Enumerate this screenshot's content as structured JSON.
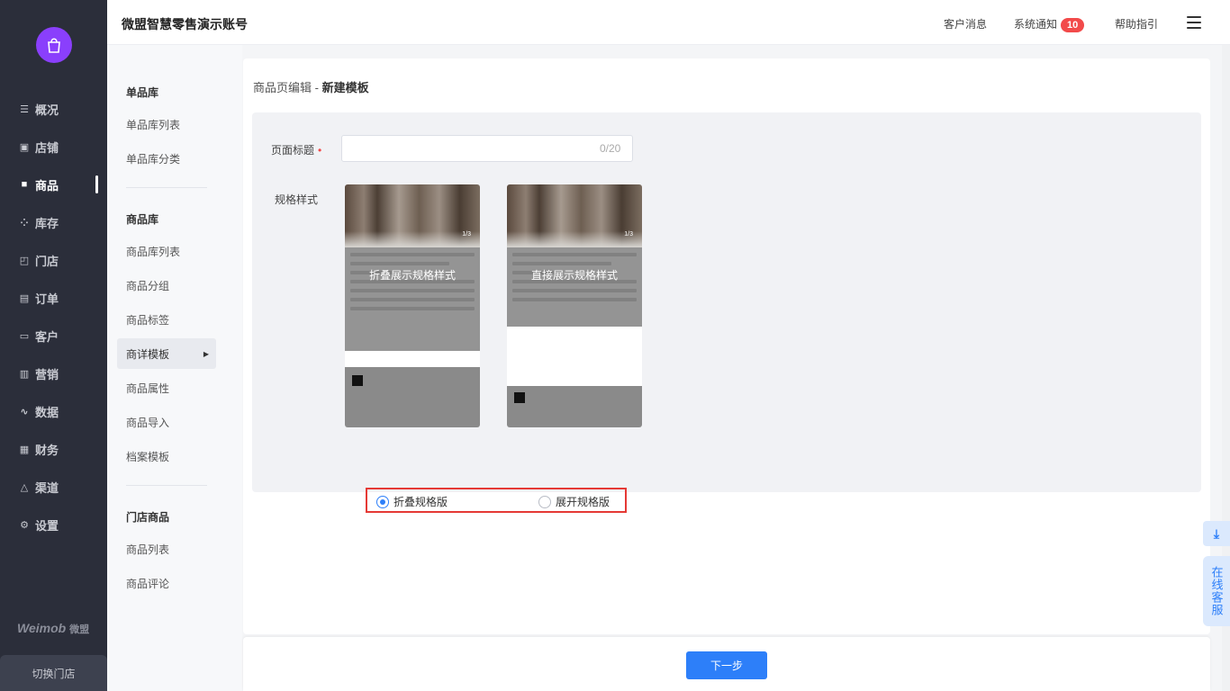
{
  "sidebar": {
    "brand": "Weimob",
    "brand_cn": "微盟",
    "switch_store": "切换门店",
    "items": [
      {
        "label": "概况",
        "icon": "list-icon"
      },
      {
        "label": "店铺",
        "icon": "shop-icon"
      },
      {
        "label": "商品",
        "icon": "goods-icon"
      },
      {
        "label": "库存",
        "icon": "inventory-icon"
      },
      {
        "label": "门店",
        "icon": "store-icon"
      },
      {
        "label": "订单",
        "icon": "order-icon"
      },
      {
        "label": "客户",
        "icon": "customer-icon"
      },
      {
        "label": "营销",
        "icon": "marketing-icon"
      },
      {
        "label": "数据",
        "icon": "data-icon"
      },
      {
        "label": "财务",
        "icon": "finance-icon"
      },
      {
        "label": "渠道",
        "icon": "channel-icon"
      },
      {
        "label": "设置",
        "icon": "settings-icon"
      }
    ],
    "active": "商品"
  },
  "header": {
    "account": "微盟智慧零售演示账号",
    "customer_msg": "客户消息",
    "notice": "系统通知",
    "notice_count": "10",
    "help": "帮助指引"
  },
  "subnav": {
    "group1": "单品库",
    "group1_items": [
      "单品库列表",
      "单品库分类"
    ],
    "group2": "商品库",
    "group2_items": [
      "商品库列表",
      "商品分组",
      "商品标签",
      "商详模板",
      "商品属性",
      "商品导入",
      "档案模板"
    ],
    "group3": "门店商品",
    "group3_items": [
      "商品列表",
      "商品评论"
    ],
    "active": "商详模板"
  },
  "main": {
    "crumb_prefix": "商品页编辑 - ",
    "crumb_current": "新建模板",
    "title_label": "页面标题",
    "title_required": "•",
    "title_value": "",
    "title_counter": "0/20",
    "spec_label": "规格样式",
    "preview_collapsed": "折叠展示规格样式",
    "preview_expanded": "直接展示规格样式",
    "preview_page": "1/3",
    "option_collapsed": "折叠规格版",
    "option_expanded": "展开规格版",
    "selected_option": "collapsed"
  },
  "footer": {
    "next": "下一步"
  },
  "floating": {
    "download_icon": "download-icon",
    "customer_service": "在线客服"
  },
  "colors": {
    "sidebar_bg": "#2b2e3a",
    "accent": "#2d7ff9",
    "badge": "#f24a4a",
    "highlight_box": "#e53935"
  }
}
